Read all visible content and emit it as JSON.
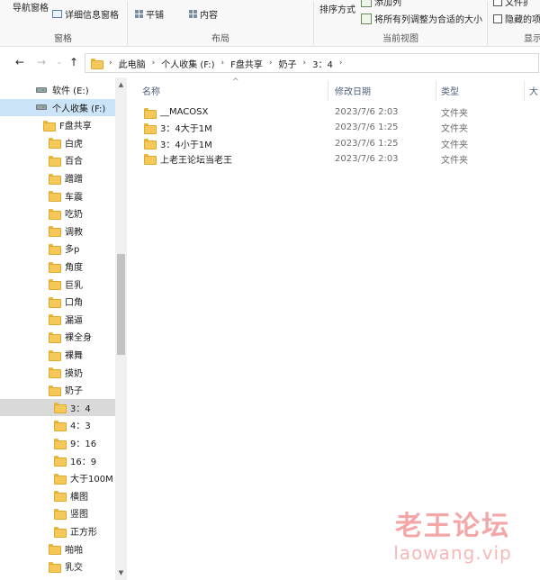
{
  "ribbon": {
    "nav_pane_label": "导航窗格",
    "details_pane_label": "详细信息窗格",
    "panes_group": "窗格",
    "tile_label": "平铺",
    "content_label": "内容",
    "layout_group": "布局",
    "sort_label": "排序方式",
    "add_column_label": "添加列",
    "fit_columns_label": "将所有列调整为合适的大小",
    "current_view_group": "当前视图",
    "file_ext_label": "文件扩",
    "hide_label": "隐藏的项",
    "show_group": "显示"
  },
  "breadcrumb": [
    "此电脑",
    "个人收集 (F:)",
    "F盘共享",
    "奶子",
    "3：4"
  ],
  "nav_tree": [
    {
      "label": "软件 (E:)",
      "kind": "drive",
      "indent": 1
    },
    {
      "label": "个人收集 (F:)",
      "kind": "drive",
      "indent": 1,
      "selected": true
    },
    {
      "label": "F盘共享",
      "kind": "folder",
      "indent": 2
    },
    {
      "label": "白虎",
      "kind": "folder",
      "indent": 3
    },
    {
      "label": "百合",
      "kind": "folder",
      "indent": 3
    },
    {
      "label": "蹭蹭",
      "kind": "folder",
      "indent": 3
    },
    {
      "label": "车震",
      "kind": "folder",
      "indent": 3
    },
    {
      "label": "吃奶",
      "kind": "folder",
      "indent": 3
    },
    {
      "label": "调教",
      "kind": "folder",
      "indent": 3
    },
    {
      "label": "多p",
      "kind": "folder",
      "indent": 3
    },
    {
      "label": "角度",
      "kind": "folder",
      "indent": 3
    },
    {
      "label": "巨乳",
      "kind": "folder",
      "indent": 3
    },
    {
      "label": "口角",
      "kind": "folder",
      "indent": 3
    },
    {
      "label": "漏逼",
      "kind": "folder",
      "indent": 3
    },
    {
      "label": "裸全身",
      "kind": "folder",
      "indent": 3
    },
    {
      "label": "裸舞",
      "kind": "folder",
      "indent": 3
    },
    {
      "label": "摸奶",
      "kind": "folder",
      "indent": 3
    },
    {
      "label": "奶子",
      "kind": "folder",
      "indent": 3
    },
    {
      "label": "3：4",
      "kind": "folder",
      "indent": 4,
      "current": true
    },
    {
      "label": "4：3",
      "kind": "folder",
      "indent": 4
    },
    {
      "label": "9：16",
      "kind": "folder",
      "indent": 4
    },
    {
      "label": "16：9",
      "kind": "folder",
      "indent": 4
    },
    {
      "label": "大于100M",
      "kind": "folder",
      "indent": 4
    },
    {
      "label": "横图",
      "kind": "folder",
      "indent": 4
    },
    {
      "label": "竖图",
      "kind": "folder",
      "indent": 4
    },
    {
      "label": "正方形",
      "kind": "folder",
      "indent": 4
    },
    {
      "label": "啪啪",
      "kind": "folder",
      "indent": 3
    },
    {
      "label": "乳交",
      "kind": "folder",
      "indent": 3
    }
  ],
  "columns": {
    "name": "名称",
    "date": "修改日期",
    "type": "类型",
    "size": "大"
  },
  "files": [
    {
      "name": "__MACOSX",
      "date": "2023/7/6 2:03",
      "type": "文件夹"
    },
    {
      "name": "3：4大于1M",
      "date": "2023/7/6 1:25",
      "type": "文件夹"
    },
    {
      "name": "3：4小于1M",
      "date": "2023/7/6 1:25",
      "type": "文件夹"
    },
    {
      "name": "上老王论坛当老王",
      "date": "2023/7/6 2:03",
      "type": "文件夹"
    }
  ],
  "watermark": {
    "title": "老王论坛",
    "url": "laowang.vip"
  }
}
